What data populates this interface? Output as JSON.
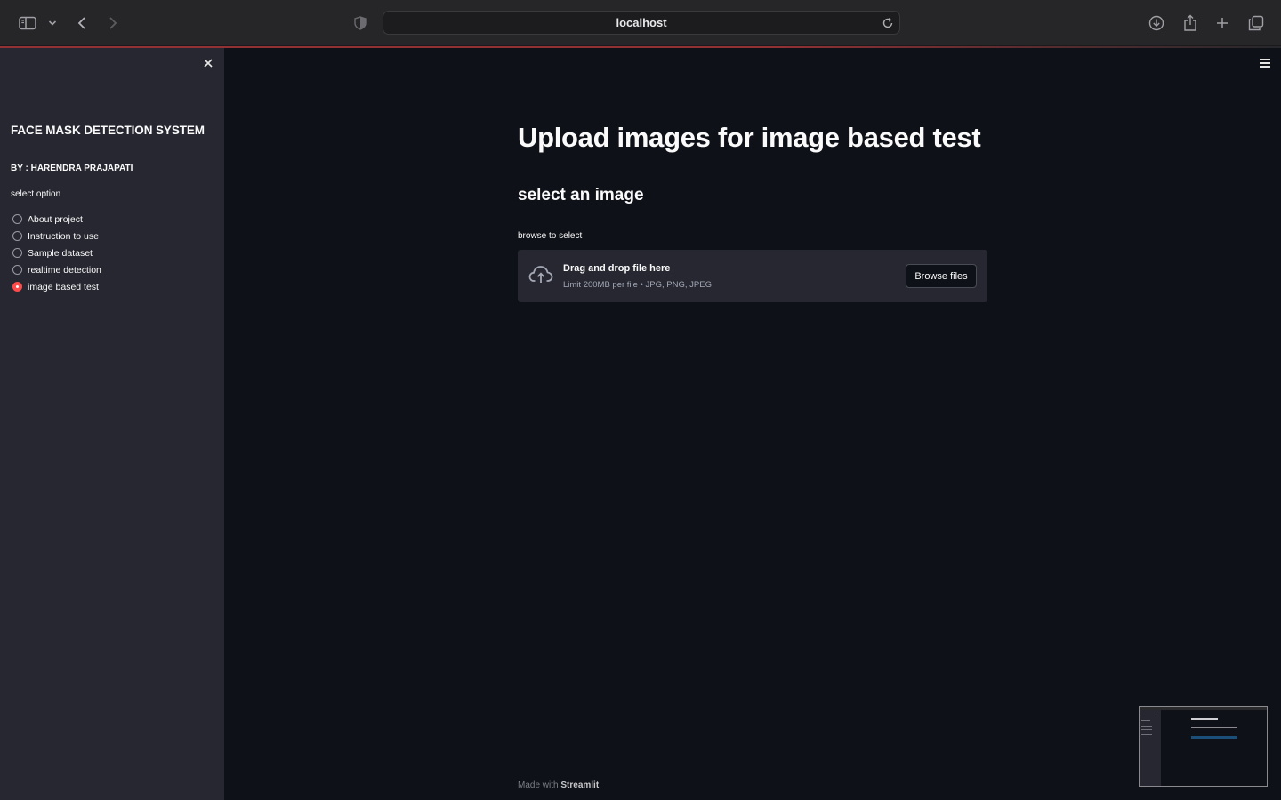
{
  "browser": {
    "url": "localhost"
  },
  "sidebar": {
    "title": "FACE MASK DETECTION SYSTEM",
    "author": "BY : HARENDRA PRAJAPATI",
    "radio_label": "select option",
    "options": [
      {
        "label": "About project",
        "selected": false
      },
      {
        "label": "Instruction to use",
        "selected": false
      },
      {
        "label": "Sample dataset",
        "selected": false
      },
      {
        "label": "realtime detection",
        "selected": false
      },
      {
        "label": "image based test",
        "selected": true
      }
    ]
  },
  "main": {
    "title": "Upload images for image based test",
    "subheader": "select an image",
    "uploader": {
      "label": "browse to select",
      "drop_title": "Drag and drop file here",
      "drop_subtitle": "Limit 200MB per file • JPG, PNG, JPEG",
      "browse_button": "Browse files"
    },
    "footer": {
      "prefix": "Made with",
      "brand": "Streamlit"
    }
  },
  "colors": {
    "accent": "#ff4b4b",
    "background": "#0e1117",
    "sidebar": "#262730"
  }
}
